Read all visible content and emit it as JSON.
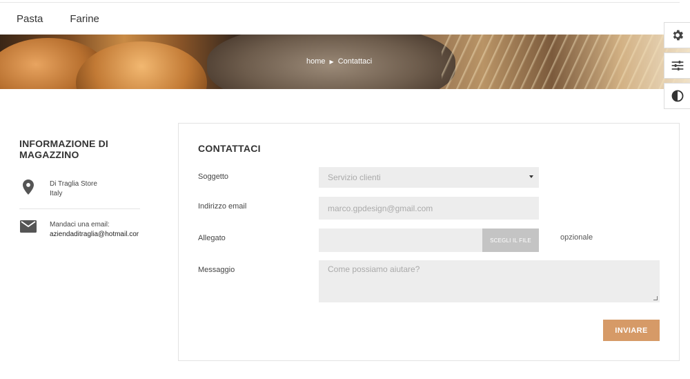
{
  "nav": {
    "items": [
      "Pasta",
      "Farine"
    ]
  },
  "breadcrumb": {
    "home": "home",
    "current": "Contattaci"
  },
  "side_tools": {
    "icons": [
      "gear-icon",
      "sliders-icon",
      "contrast-icon"
    ]
  },
  "info": {
    "title": "INFORMAZIONE DI MAGAZZINO",
    "store_name": "Di Traglia Store",
    "store_country": "Italy",
    "email_label": "Mandaci una email:",
    "email_value": "aziendaditraglia@hotmail.cor"
  },
  "form": {
    "title": "CONTATTACI",
    "subject_label": "Soggetto",
    "subject_value": "Servizio clienti",
    "email_label": "Indirizzo email",
    "email_placeholder": "marco.gpdesign@gmail.com",
    "attachment_label": "Allegato",
    "file_button": "SCEGLI IL FILE",
    "optional_note": "opzionale",
    "message_label": "Messaggio",
    "message_placeholder": "Come possiamo aiutare?",
    "submit_label": "INVIARE"
  },
  "colors": {
    "accent": "#d69a67",
    "field_bg": "#ededed",
    "file_button": "#c4c4c4"
  }
}
